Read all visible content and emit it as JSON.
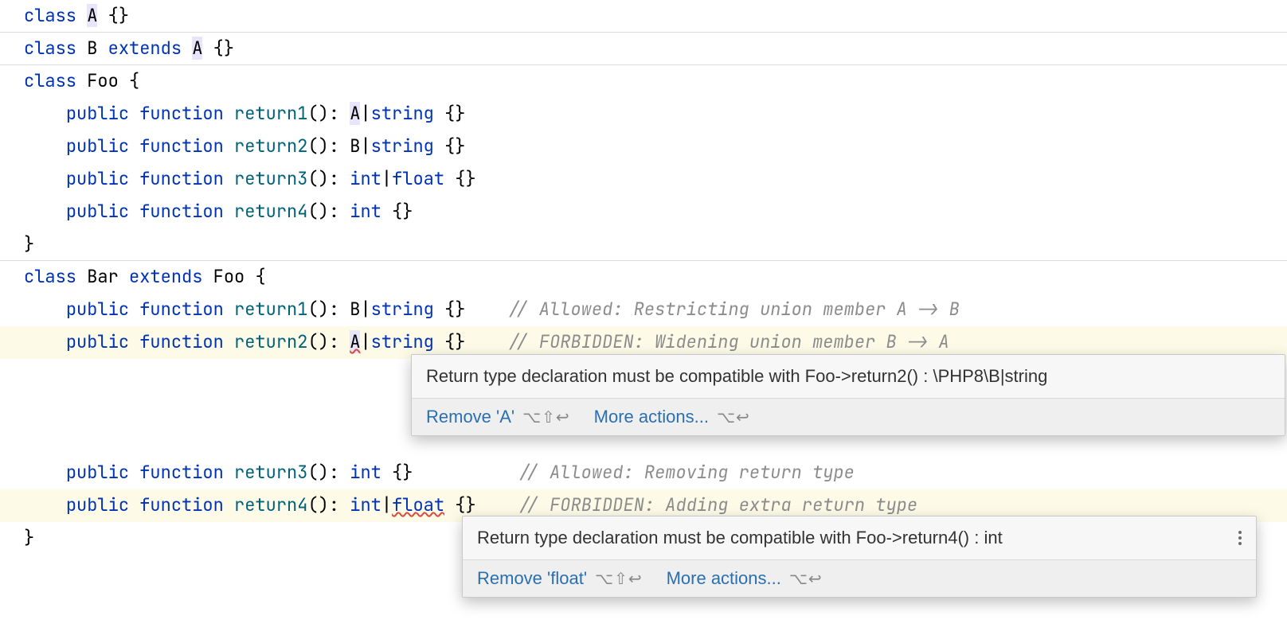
{
  "code": {
    "class_kw": "class",
    "extends_kw": "extends",
    "public_kw": "public",
    "function_kw": "function",
    "A": "A",
    "B": "B",
    "Foo": "Foo",
    "Bar": "Bar",
    "return1": "return1",
    "return2": "return2",
    "return3": "return3",
    "return4": "return4",
    "type_string": "string",
    "type_int": "int",
    "type_float": "float",
    "braces_empty": "{}",
    "brace_open": "{",
    "brace_close": "}",
    "paren_pair": "()",
    "colon": ":",
    "pipe": "|",
    "comment_allowed_restrict": "// Allowed: Restricting union member A -> B",
    "comment_forbidden_widen": "// FORBIDDEN: Widening union member B -> A",
    "comment_allowed_remove": "// Allowed: Removing return type",
    "comment_forbidden_add": "// FORBIDDEN: Adding extra return type"
  },
  "popup1": {
    "message": "Return type declaration must be compatible with Foo->return2() : \\PHP8\\B|string",
    "fix_label": "Remove 'A'",
    "fix_shortcut": "⌥⇧↩",
    "more_label": "More actions...",
    "more_shortcut": "⌥↩"
  },
  "popup2": {
    "message": "Return type declaration must be compatible with Foo->return4() : int",
    "fix_label": "Remove 'float'",
    "fix_shortcut": "⌥⇧↩",
    "more_label": "More actions...",
    "more_shortcut": "⌥↩"
  }
}
